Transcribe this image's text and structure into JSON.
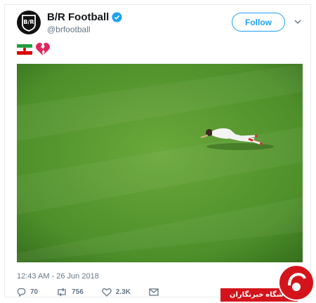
{
  "tweet": {
    "author_name": "B/R Football",
    "handle": "@brfootball",
    "follow_label": "Follow",
    "emoji": [
      "iran-flag-icon",
      "broken-heart-icon"
    ],
    "timestamp": "12:43 AM - 26 Jun 2018",
    "stats": {
      "replies": "70",
      "retweets": "756",
      "likes": "2.3K"
    }
  },
  "watermark": {
    "text": "باشگاه خبرنگاران"
  },
  "colors": {
    "accent": "#1da1f2",
    "pitch": "#4f8f2a",
    "watermark": "#d3141b"
  }
}
